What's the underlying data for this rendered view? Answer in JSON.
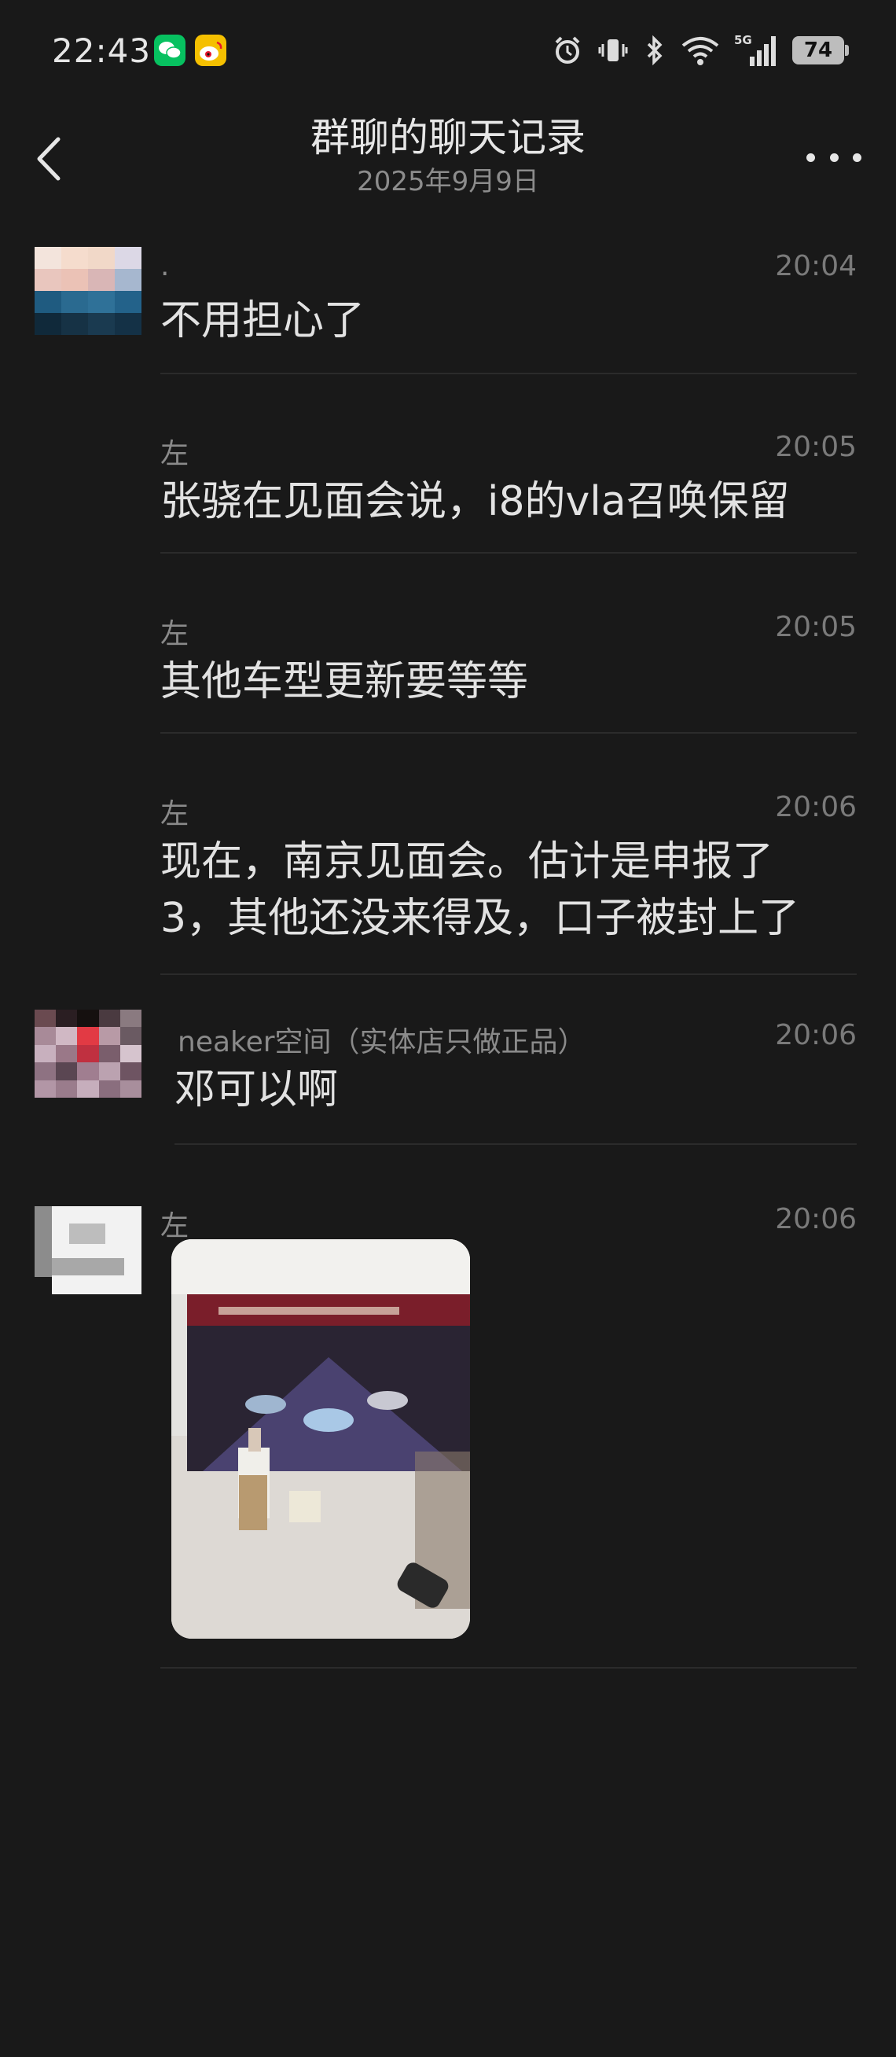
{
  "status_bar": {
    "time": "22:43",
    "apps": [
      "wechat-icon",
      "weibo-icon"
    ],
    "network": "5G",
    "battery": "74"
  },
  "nav": {
    "title": "群聊的聊天记录",
    "subtitle": "2025年9月9日"
  },
  "messages": [
    {
      "sender": ".",
      "time": "20:04",
      "text": "不用担心了"
    },
    {
      "sender": "左",
      "time": "20:05",
      "text": "张骁在见面会说，i8的vla召唤保留"
    },
    {
      "sender": "左",
      "time": "20:05",
      "text": "其他车型更新要等等"
    },
    {
      "sender": "左",
      "time": "20:06",
      "text": "现在，南京见面会。估计是申报了",
      "text2": "3，其他还没来得及，口子被封上了"
    },
    {
      "sender": "neaker空间（实体店只做正品）",
      "time": "20:06",
      "text": "邓可以啊"
    },
    {
      "sender": "左",
      "time": "20:06",
      "image": "photo-of-car-presentation-event"
    }
  ]
}
